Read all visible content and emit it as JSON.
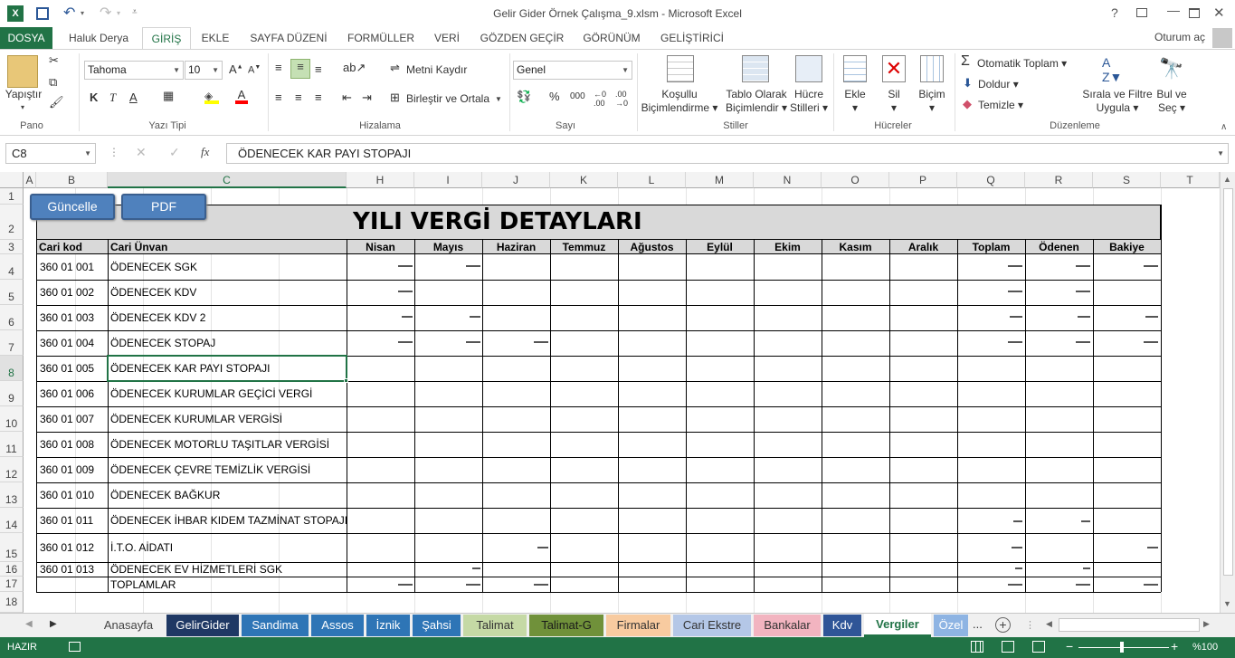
{
  "window": {
    "title": "Gelir Gider Örnek Çalışma_9.xlsm - Microsoft Excel",
    "controls": [
      "?",
      "▢",
      "—",
      "☐",
      "✕"
    ]
  },
  "quick_access": [
    "save",
    "undo",
    "redo"
  ],
  "ribbon_tabs": [
    "DOSYA",
    "Haluk Derya",
    "GİRİŞ",
    "EKLE",
    "SAYFA DÜZENİ",
    "FORMÜLLER",
    "VERİ",
    "GÖZDEN GEÇİR",
    "GÖRÜNÜM",
    "GELİŞTİRİCİ"
  ],
  "account": "Oturum aç",
  "ribbon": {
    "pano": {
      "label": "Pano",
      "paste": "Yapıştır"
    },
    "font": {
      "label": "Yazı Tipi",
      "name": "Tahoma",
      "size": "10",
      "bold": "K",
      "italic": "T",
      "underline": "A"
    },
    "align": {
      "label": "Hizalama",
      "wrap": "Metni Kaydır",
      "merge": "Birleştir ve Ortala"
    },
    "number": {
      "label": "Sayı",
      "format": "Genel",
      "percent": "%",
      "thousands": "000"
    },
    "styles": {
      "label": "Stiller",
      "cond1": "Koşullu",
      "cond2": "Biçimlendirme",
      "table1": "Tablo Olarak",
      "table2": "Biçimlendir",
      "cell1": "Hücre",
      "cell2": "Stilleri"
    },
    "cells": {
      "label": "Hücreler",
      "insert": "Ekle",
      "delete": "Sil",
      "format": "Biçim"
    },
    "editing": {
      "label": "Düzenleme",
      "autosum": "Otomatik Toplam",
      "fill": "Doldur",
      "clear": "Temizle",
      "sort1": "Sırala ve Filtre",
      "sort2": "Uygula",
      "find1": "Bul ve",
      "find2": "Seç"
    }
  },
  "formula_bar": {
    "namebox": "C8",
    "content": "ÖDENECEK KAR PAYI STOPAJI"
  },
  "columns": [
    "A",
    "B",
    "C",
    "H",
    "I",
    "J",
    "K",
    "L",
    "M",
    "N",
    "O",
    "P",
    "Q",
    "R",
    "S",
    "T"
  ],
  "rows": [
    "1",
    "2",
    "3",
    "4",
    "5",
    "6",
    "7",
    "8",
    "9",
    "10",
    "11",
    "12",
    "13",
    "14",
    "15",
    "16",
    "17",
    "18"
  ],
  "sheet": {
    "buttons": [
      "Güncelle",
      "PDF"
    ],
    "title": "YILI VERGİ DETAYLARI",
    "headers": {
      "code": "Cari kod",
      "name": "Cari Ünvan",
      "months": [
        "Nisan",
        "Mayıs",
        "Haziran",
        "Temmuz",
        "Ağustos",
        "Eylül",
        "Ekim",
        "Kasım",
        "Aralık"
      ],
      "total": "Toplam",
      "paid": "Ödenen",
      "balance": "Bakiye"
    },
    "records": [
      {
        "code": "360 01 001",
        "name": "ÖDENECEK SGK"
      },
      {
        "code": "360 01 002",
        "name": "ÖDENECEK KDV"
      },
      {
        "code": "360 01 003",
        "name": "ÖDENECEK KDV 2"
      },
      {
        "code": "360 01 004",
        "name": "ÖDENECEK STOPAJ"
      },
      {
        "code": "360 01 005",
        "name": "ÖDENECEK KAR PAYI STOPAJI"
      },
      {
        "code": "360 01 006",
        "name": "ÖDENECEK KURUMLAR GEÇİCİ VERGİ"
      },
      {
        "code": "360 01 007",
        "name": "ÖDENECEK KURUMLAR VERGİSİ"
      },
      {
        "code": "360 01 008",
        "name": "ÖDENECEK MOTORLU TAŞITLAR VERGİSİ"
      },
      {
        "code": "360 01 009",
        "name": "ÖDENECEK ÇEVRE TEMİZLİK VERGİSİ"
      },
      {
        "code": "360 01 010",
        "name": "ÖDENECEK BAĞKUR"
      },
      {
        "code": "360 01 011",
        "name": "ÖDENECEK İHBAR KIDEM TAZMİNAT STOPAJI"
      },
      {
        "code": "360 01 012",
        "name": "İ.T.O. AİDATI"
      },
      {
        "code": "360 01 013",
        "name": "ÖDENECEK EV HİZMETLERİ SGK"
      }
    ],
    "total_label": "TOPLAMLAR"
  },
  "sheet_tabs": [
    {
      "name": "Anasayfa",
      "color": "#f0f0f0",
      "text": "#444444"
    },
    {
      "name": "GelirGider",
      "color": "#1f3864",
      "text": "#ffffff"
    },
    {
      "name": "Sandima",
      "color": "#2e75b6",
      "text": "#ffffff"
    },
    {
      "name": "Assos",
      "color": "#2e75b6",
      "text": "#ffffff"
    },
    {
      "name": "İznik",
      "color": "#2e75b6",
      "text": "#ffffff"
    },
    {
      "name": "Şahsi",
      "color": "#2e75b6",
      "text": "#ffffff"
    },
    {
      "name": "Talimat",
      "color": "#c5d9a5",
      "text": "#333333"
    },
    {
      "name": "Talimat-G",
      "color": "#70913a",
      "text": "#1a1a1a"
    },
    {
      "name": "Firmalar",
      "color": "#f8cba0",
      "text": "#333333"
    },
    {
      "name": "Cari Ekstre",
      "color": "#b4c7e7",
      "text": "#333333"
    },
    {
      "name": "Bankalar",
      "color": "#f2b4c0",
      "text": "#333333"
    },
    {
      "name": "Kdv",
      "color": "#2f5597",
      "text": "#ffffff"
    },
    {
      "name": "Vergiler",
      "color": "#ffffff",
      "text": "#217346"
    },
    {
      "name": "Özel",
      "color": "#8eb4e3",
      "text": "#ffffff"
    }
  ],
  "status": {
    "mode": "HAZIR",
    "zoom": "%100"
  },
  "colors": {
    "excel_green": "#217346",
    "button_blue": "#4f81bd",
    "title_bg": "#d9d9d9"
  }
}
